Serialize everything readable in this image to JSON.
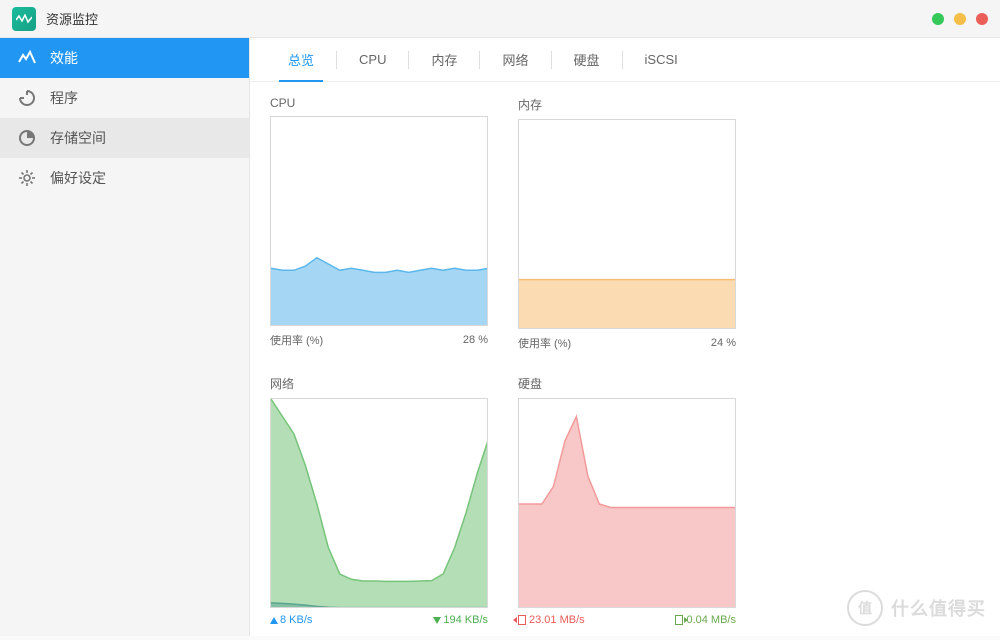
{
  "window": {
    "title": "资源监控"
  },
  "sidebar": {
    "items": [
      {
        "label": "效能",
        "icon": "performance-icon"
      },
      {
        "label": "程序",
        "icon": "process-icon"
      },
      {
        "label": "存储空间",
        "icon": "storage-icon"
      },
      {
        "label": "偏好设定",
        "icon": "gear-icon"
      }
    ]
  },
  "tabs": [
    "总览",
    "CPU",
    "内存",
    "网络",
    "硬盘",
    "iSCSI"
  ],
  "charts": {
    "cpu": {
      "title": "CPU",
      "footer_left": "使用率 (%)",
      "footer_right": "28 %"
    },
    "mem": {
      "title": "内存",
      "footer_left": "使用率 (%)",
      "footer_right": "24 %"
    },
    "net": {
      "title": "网络",
      "up": "8 KB/s",
      "down": "194 KB/s"
    },
    "disk": {
      "title": "硬盘",
      "read": "23.01 MB/s",
      "write": "0.04 MB/s"
    }
  },
  "watermark": {
    "badge": "值",
    "text": "什么值得买"
  },
  "chart_data": [
    {
      "type": "area",
      "id": "cpu",
      "title": "CPU",
      "ylabel": "使用率 (%)",
      "ylim": [
        0,
        100
      ],
      "x": [
        0,
        1,
        2,
        3,
        4,
        5,
        6,
        7,
        8,
        9,
        10,
        11,
        12,
        13,
        14,
        15,
        16,
        17,
        18,
        19
      ],
      "series": [
        {
          "name": "CPU",
          "color": "#5bb7eb",
          "values": [
            28,
            27,
            27,
            29,
            33,
            30,
            27,
            28,
            27,
            26,
            26,
            27,
            26,
            27,
            28,
            27,
            28,
            27,
            27,
            28
          ]
        }
      ]
    },
    {
      "type": "area",
      "id": "mem",
      "title": "内存",
      "ylabel": "使用率 (%)",
      "ylim": [
        0,
        100
      ],
      "x": [
        0,
        1,
        2,
        3,
        4,
        5,
        6,
        7,
        8,
        9,
        10,
        11,
        12,
        13,
        14,
        15,
        16,
        17,
        18,
        19
      ],
      "series": [
        {
          "name": "内存",
          "color": "#f7be72",
          "values": [
            24,
            24,
            24,
            24,
            24,
            24,
            24,
            24,
            24,
            24,
            24,
            24,
            24,
            24,
            24,
            24,
            24,
            24,
            24,
            24
          ]
        }
      ]
    },
    {
      "type": "area",
      "id": "net",
      "title": "网络",
      "ylabel": "KB/s",
      "ylim": [
        0,
        1200
      ],
      "x": [
        0,
        1,
        2,
        3,
        4,
        5,
        6,
        7,
        8,
        9,
        10,
        11,
        12,
        13,
        14,
        15,
        16,
        17,
        18,
        19
      ],
      "series": [
        {
          "name": "下载",
          "color": "#76c47a",
          "values": [
            1200,
            1100,
            1000,
            820,
            600,
            350,
            200,
            170,
            160,
            160,
            158,
            158,
            158,
            160,
            162,
            200,
            350,
            550,
            780,
            980
          ]
        },
        {
          "name": "上传",
          "color": "#3a7fb0",
          "values": [
            35,
            32,
            28,
            22,
            15,
            10,
            8,
            8,
            8,
            8,
            8,
            8,
            8,
            8,
            8,
            8,
            8,
            8,
            8,
            8
          ]
        }
      ]
    },
    {
      "type": "area",
      "id": "disk",
      "title": "硬盘",
      "ylabel": "MB/s",
      "ylim": [
        0,
        60
      ],
      "x": [
        0,
        1,
        2,
        3,
        4,
        5,
        6,
        7,
        8,
        9,
        10,
        11,
        12,
        13,
        14,
        15,
        16,
        17,
        18,
        19
      ],
      "series": [
        {
          "name": "读取",
          "color": "#f29a9a",
          "values": [
            30,
            30,
            30,
            35,
            48,
            55,
            38,
            30,
            29,
            29,
            29,
            29,
            29,
            29,
            29,
            29,
            29,
            29,
            29,
            29
          ]
        },
        {
          "name": "写入",
          "color": "#8bc08b",
          "values": [
            0.04,
            0.04,
            0.04,
            0.04,
            0.04,
            0.04,
            0.04,
            0.04,
            0.04,
            0.04,
            0.04,
            0.04,
            0.04,
            0.04,
            0.04,
            0.04,
            0.04,
            0.04,
            0.04,
            0.04
          ]
        }
      ]
    }
  ]
}
